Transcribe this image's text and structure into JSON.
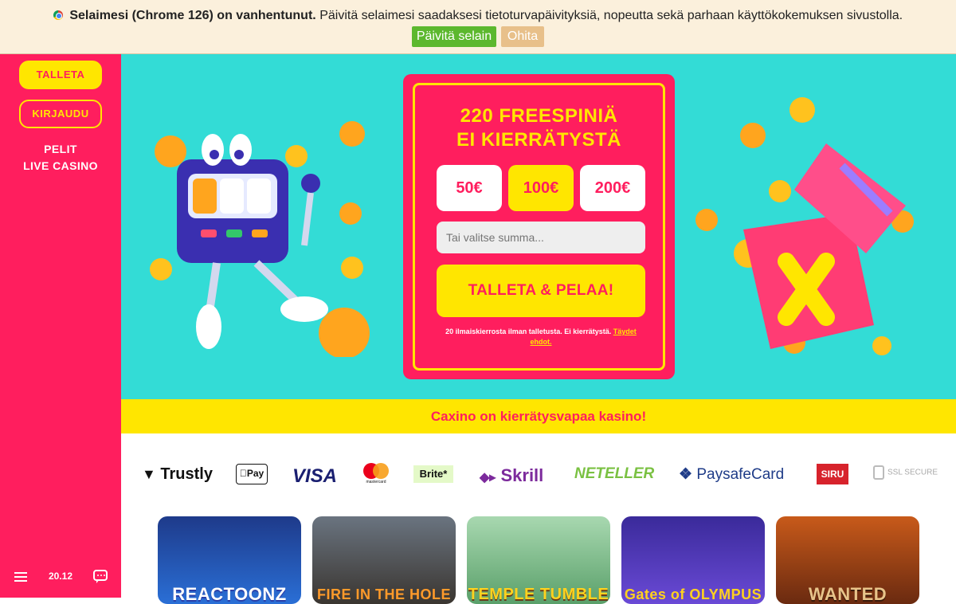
{
  "banner": {
    "bold": "Selaimesi (Chrome 126) on vanhentunut.",
    "text": "Päivitä selaimesi saadaksesi tietoturvapäivityksiä, nopeutta sekä parhaan käyttökokemuksen sivustolla.",
    "update_label": "Päivitä selain",
    "skip_label": "Ohita",
    "update_color": "#5cb82e",
    "skip_color": "#e8c08a"
  },
  "sidebar": {
    "deposit_label": "TALLETA",
    "login_label": "KIRJAUDU",
    "links": [
      "PELIT",
      "LIVE CASINO"
    ],
    "clock": "20.12",
    "accent": "#ff1e5e",
    "yellow": "#ffe600"
  },
  "offer": {
    "title_line1": "220 FREESPINIÄ",
    "title_line2": "EI KIERRÄTYSTÄ",
    "amounts": [
      "50€",
      "100€",
      "200€"
    ],
    "selected_amount": "100€",
    "input_placeholder": "Tai valitse summa...",
    "cta_label": "TALLETA & PELAA!",
    "terms_text": "20 ilmaiskierrosta ilman talletusta. Ei kierrätystä.",
    "terms_link": "Täydet ehdot."
  },
  "tagline": "Caxino on kierrätysvapaa kasino!",
  "payments": [
    "Trustly",
    "Pay",
    "VISA",
    "mastercard",
    "Brite*",
    "Skrill",
    "NETELLER",
    "PaysafeCard",
    "SIRU",
    "SSL SECURE"
  ],
  "games": [
    "REACTOONZ",
    "FIRE IN THE HOLE",
    "TEMPLE TUMBLE",
    "Gates of OLYMPUS",
    "WANTED"
  ]
}
